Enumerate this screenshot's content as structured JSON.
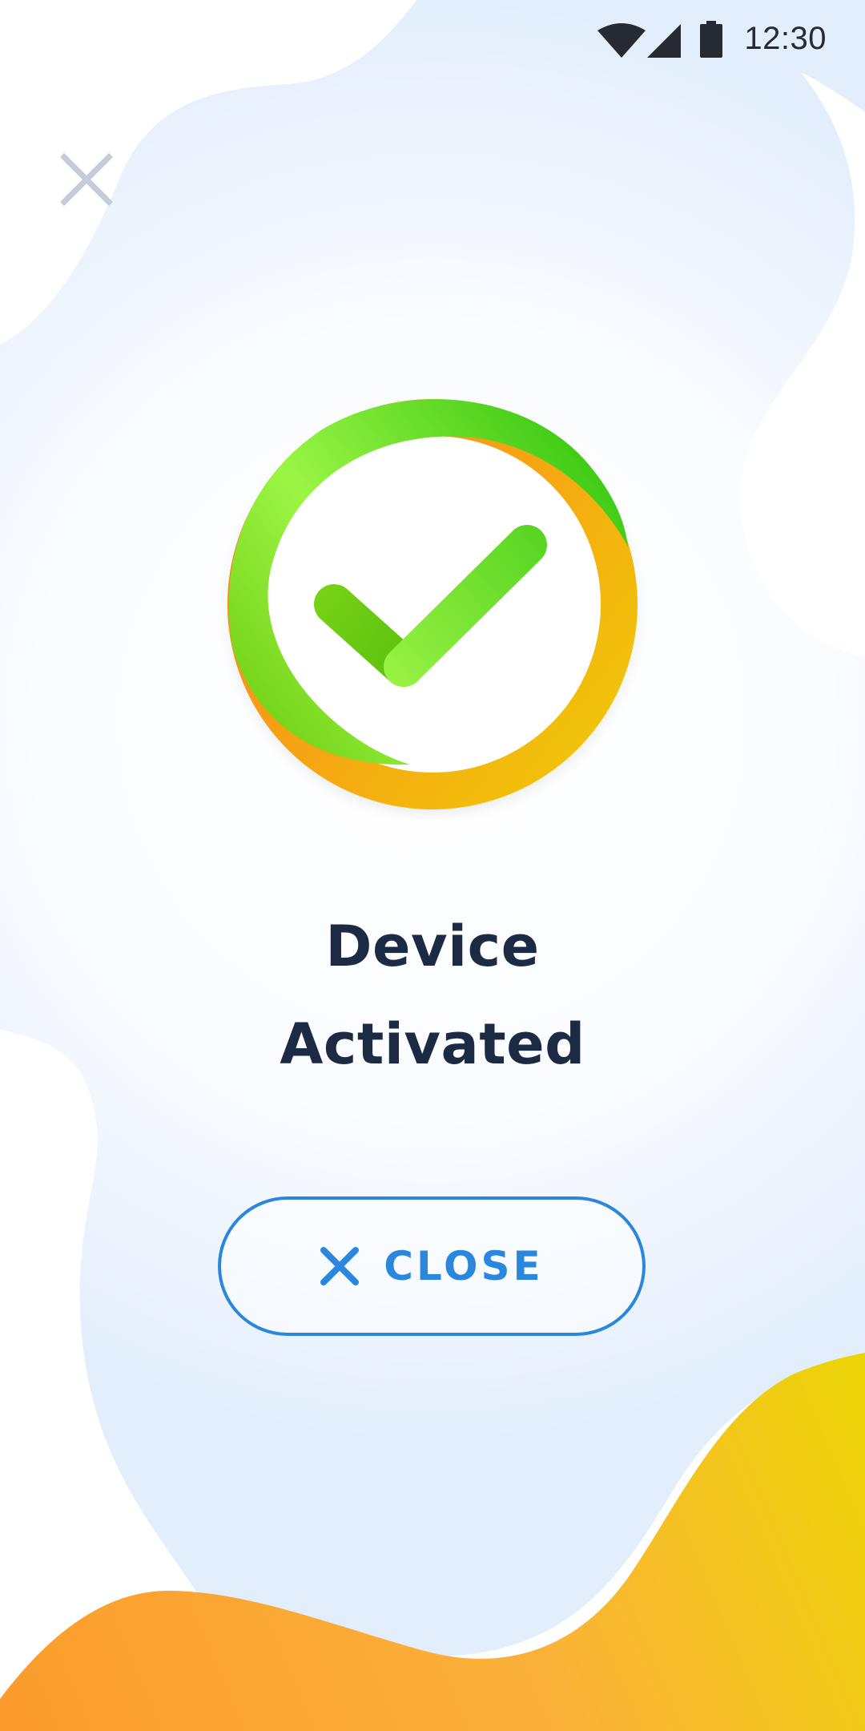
{
  "status_bar": {
    "time": "12:30",
    "icons": [
      "wifi-icon",
      "cellular-signal-icon",
      "battery-icon"
    ]
  },
  "dismiss": {
    "icon": "close-icon"
  },
  "emblem": {
    "icon": "checkmark-icon"
  },
  "title": {
    "line1": "Device",
    "line2": "Activated"
  },
  "close_button": {
    "label": "CLOSE",
    "icon": "close-icon"
  },
  "colors": {
    "title_text": "#1c2b43",
    "accent_blue": "#2b86de",
    "success_green": "#5fd11f",
    "warm_orange": "#fba22e",
    "warm_yellow": "#ecd506",
    "background_tint": "#e8f1fc",
    "dismiss_gray": "#c4ccd6"
  }
}
